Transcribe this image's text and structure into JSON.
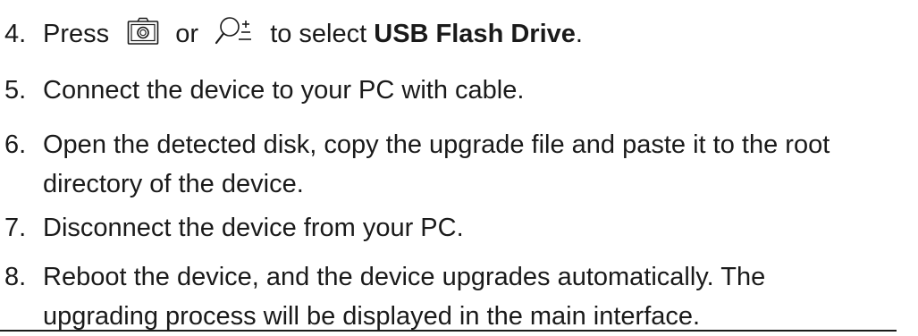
{
  "steps": [
    {
      "number": "4.",
      "press": "Press",
      "camera_icon": "camera-icon",
      "or": "or",
      "zoom_icon": "zoom-plus-minus-icon",
      "to_select": "to select",
      "target": "USB Flash Drive",
      "period": "."
    },
    {
      "number": "5.",
      "text": "Connect the device to your PC with cable."
    },
    {
      "number": "6.",
      "line1": "Open the detected disk, copy the upgrade file and paste it to the root",
      "line2": "directory of the device."
    },
    {
      "number": "7.",
      "text": "Disconnect the device from your PC."
    },
    {
      "number": "8.",
      "line1": "Reboot the device, and the device upgrades automatically. The",
      "line2": "upgrading process will be displayed in the main interface."
    }
  ],
  "colors": {
    "text": "#1a1a1a",
    "background": "#ffffff"
  }
}
